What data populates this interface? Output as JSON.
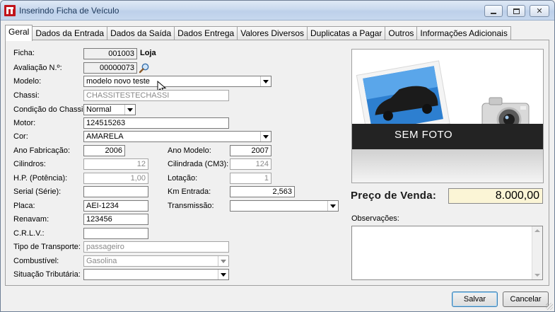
{
  "window": {
    "title": "Inserindo Ficha de Veículo"
  },
  "tabs": [
    {
      "label": "Geral"
    },
    {
      "label": "Dados da Entrada"
    },
    {
      "label": "Dados da Saída"
    },
    {
      "label": "Dados Entrega"
    },
    {
      "label": "Valores Diversos"
    },
    {
      "label": "Duplicatas a Pagar"
    },
    {
      "label": "Outros"
    },
    {
      "label": "Informações Adicionais"
    }
  ],
  "form": {
    "ficha": {
      "label": "Ficha:",
      "value": "001003",
      "suffix": "Loja"
    },
    "avaliacao": {
      "label": "Avaliação N.º:",
      "value": "00000073"
    },
    "modelo": {
      "label": "Modelo:",
      "value": "modelo novo teste"
    },
    "chassi": {
      "label": "Chassi:",
      "value": "CHASSITESTECHASSI"
    },
    "condicao_chassi": {
      "label": "Condição do Chassi:",
      "value": "Normal"
    },
    "motor": {
      "label": "Motor:",
      "value": "124515263"
    },
    "cor": {
      "label": "Cor:",
      "value": "AMARELA"
    },
    "ano_fabricacao": {
      "label": "Ano Fabricação:",
      "value": "2006"
    },
    "ano_modelo": {
      "label": "Ano Modelo:",
      "value": "2007"
    },
    "cilindros": {
      "label": "Cilindros:",
      "value": "12"
    },
    "cilindrada": {
      "label": "Cilindrada (CM3):",
      "value": "124"
    },
    "hp": {
      "label": "H.P. (Potência):",
      "value": "1,00"
    },
    "lotacao": {
      "label": "Lotação:",
      "value": "1"
    },
    "serial": {
      "label": "Serial (Série):",
      "value": ""
    },
    "km_entrada": {
      "label": "Km Entrada:",
      "value": "2,563"
    },
    "placa": {
      "label": "Placa:",
      "value": "AEI-1234"
    },
    "transmissao": {
      "label": "Transmissão:",
      "value": ""
    },
    "renavam": {
      "label": "Renavam:",
      "value": "123456"
    },
    "crlv": {
      "label": "C.R.L.V.:",
      "value": ""
    },
    "tipo_transporte": {
      "label": "Tipo de Transporte:",
      "value": "passageiro"
    },
    "combustivel": {
      "label": "Combustível:",
      "value": "Gasolina"
    },
    "situacao_tributaria": {
      "label": "Situação Tributária:",
      "value": ""
    }
  },
  "photo": {
    "label": "SEM FOTO"
  },
  "price": {
    "label": "Preço de Venda:",
    "value": "8.000,00"
  },
  "observacoes": {
    "label": "Observações:",
    "value": ""
  },
  "buttons": {
    "save": "Salvar",
    "cancel": "Cancelar"
  },
  "colors": {
    "price_bg": "#fbf5d6",
    "photo_band": "#232323",
    "car_blue": "#2d7fd0"
  }
}
